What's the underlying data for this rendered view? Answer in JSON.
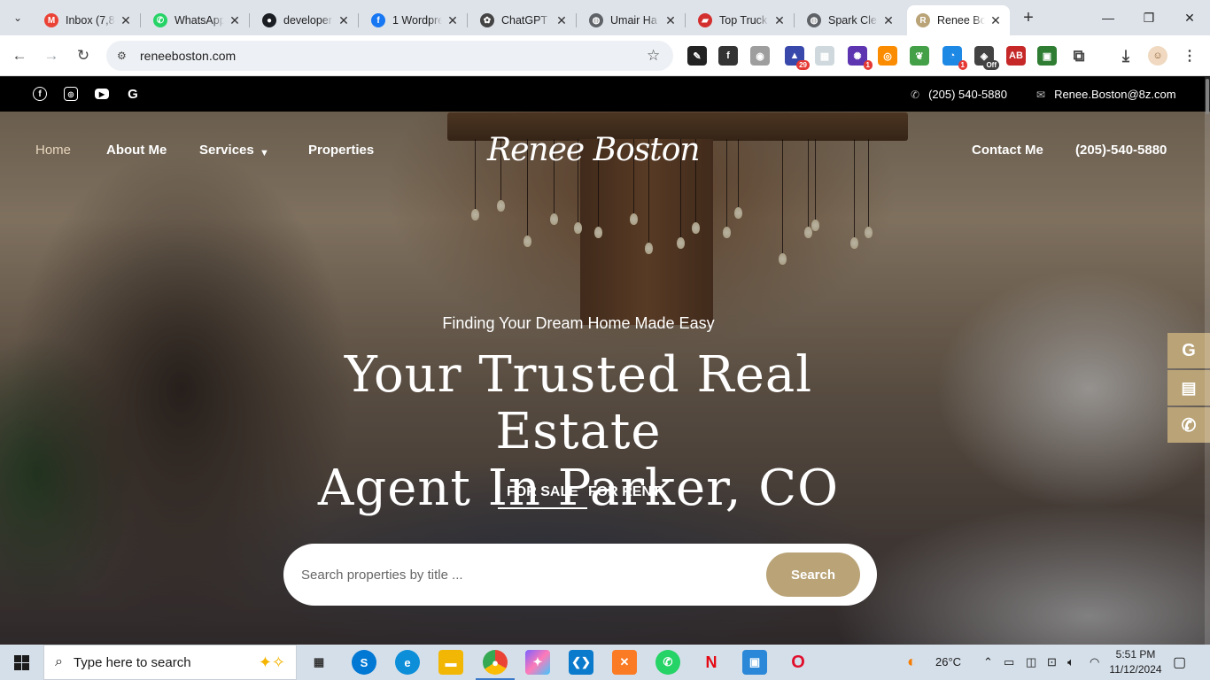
{
  "browser": {
    "tabs": [
      {
        "title": "Inbox (7,8",
        "icon": "gmail-icon",
        "color": "#ea4335"
      },
      {
        "title": "WhatsApp",
        "icon": "whatsapp-icon",
        "color": "#25d366"
      },
      {
        "title": "developer",
        "icon": "github-icon",
        "color": "#1b1f23"
      },
      {
        "title": "1 Wordpre",
        "icon": "facebook-icon",
        "color": "#1877f2"
      },
      {
        "title": "ChatGPT",
        "icon": "chatgpt-icon",
        "color": "#444444"
      },
      {
        "title": "Umair Ha",
        "icon": "globe-icon",
        "color": "#5f6368"
      },
      {
        "title": "Top Truck",
        "icon": "truck-icon",
        "color": "#d32f2f"
      },
      {
        "title": "Spark Cle",
        "icon": "globe-icon",
        "color": "#5f6368"
      },
      {
        "title": "Renee Bo",
        "icon": "renee-boston-icon",
        "color": "#b9a377"
      }
    ],
    "url": "reneeboston.com",
    "extensions": [
      {
        "icon": "eyedropper-icon",
        "color": "#222222",
        "badge": ""
      },
      {
        "icon": "font-icon",
        "color": "#333333",
        "badge": ""
      },
      {
        "icon": "camera-icon",
        "color": "#9e9e9e",
        "badge": ""
      },
      {
        "icon": "mortarboard-icon",
        "color": "#3949ab",
        "badge": "29"
      },
      {
        "icon": "grid-icon",
        "color": "#cfd8dc",
        "badge": ""
      },
      {
        "icon": "color-wheel-icon",
        "color": "#5e35b1",
        "badge": "1"
      },
      {
        "icon": "box-icon",
        "color": "#fb8c00",
        "badge": ""
      },
      {
        "icon": "leaf-icon",
        "color": "#43a047",
        "badge": ""
      },
      {
        "icon": "cursor-icon",
        "color": "#1e88e5",
        "badge": "1"
      },
      {
        "icon": "off-icon",
        "color": "#424242",
        "badge": "Off"
      },
      {
        "icon": "adblock-icon",
        "color": "#c62828",
        "badge": ""
      },
      {
        "icon": "android-icon",
        "color": "#2e7d32",
        "badge": ""
      },
      {
        "icon": "puzzle-icon",
        "color": "#444444",
        "badge": ""
      }
    ]
  },
  "site": {
    "phone": "(205) 540-5880",
    "email": "Renee.Boston@8z.com",
    "social": [
      "facebook-icon",
      "instagram-icon",
      "youtube-icon",
      "google-icon"
    ],
    "nav": {
      "home": "Home",
      "about": "About Me",
      "services": "Services",
      "properties": "Properties",
      "contact": "Contact Me",
      "phone": "(205)-540-5880"
    },
    "logo": "Renee Boston",
    "hero": {
      "eyebrow": "Finding Your Dream Home Made Easy",
      "headline_line1": "Your Trusted Real Estate",
      "headline_line2": "Agent In Parker, CO",
      "tab_sale": "FOR SALE",
      "tab_rent": "FOR RENT",
      "search_placeholder": "Search properties by title ...",
      "search_button": "Search"
    },
    "floating": [
      "google-icon",
      "clipboard-icon",
      "phone-icon"
    ],
    "accent": "#b9a377"
  },
  "taskbar": {
    "search_label": "Type here to search",
    "apps": [
      {
        "icon": "task-view-icon",
        "color": "#333333",
        "label": "▦"
      },
      {
        "icon": "skype-icon",
        "color": "#0078d4",
        "label": "S"
      },
      {
        "icon": "edge-icon",
        "color": "#0c8ed9",
        "label": "e"
      },
      {
        "icon": "file-explorer-icon",
        "color": "#f2b705",
        "label": "▬"
      },
      {
        "icon": "chrome-icon",
        "color": "#e74c3c",
        "label": "●"
      },
      {
        "icon": "copilot-icon",
        "color": "#7b61ff",
        "label": "✦"
      },
      {
        "icon": "vscode-icon",
        "color": "#0a7acc",
        "label": "❮❯"
      },
      {
        "icon": "xampp-icon",
        "color": "#fb7a24",
        "label": "✕"
      },
      {
        "icon": "whatsapp-icon",
        "color": "#25d366",
        "label": "✆"
      },
      {
        "icon": "netflix-icon",
        "color": "#e50914",
        "label": "N"
      },
      {
        "icon": "store-icon",
        "color": "#2b88d8",
        "label": "▣"
      },
      {
        "icon": "opera-icon",
        "color": "#e0102d",
        "label": "O"
      }
    ],
    "weather": "26°C",
    "time": "5:51 PM",
    "date": "11/12/2024"
  }
}
